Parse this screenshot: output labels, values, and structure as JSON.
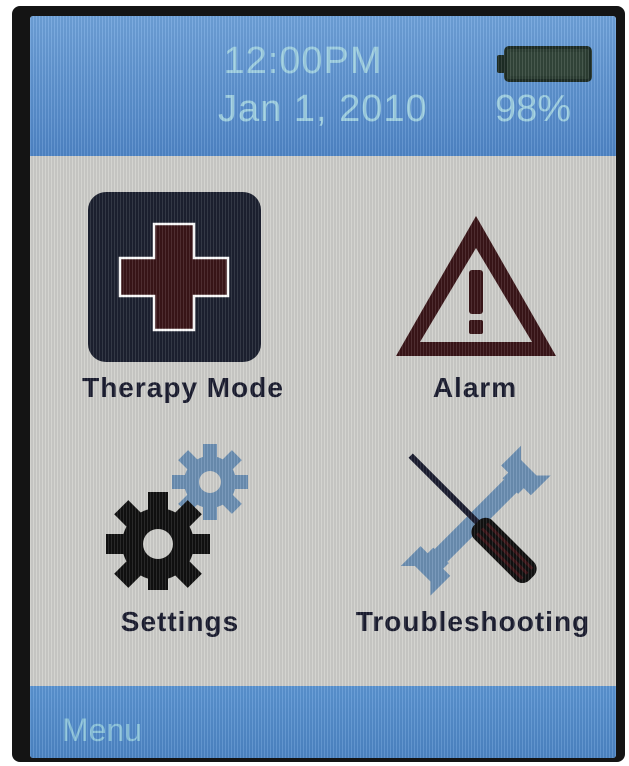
{
  "status": {
    "time": "12:00PM",
    "date": "Jan 1, 2010",
    "battery_percent": "98%",
    "battery_level": 0.98
  },
  "menu": {
    "items": [
      {
        "label": "Therapy Mode",
        "icon": "medical-cross-icon"
      },
      {
        "label": "Alarm",
        "icon": "warning-triangle-icon"
      },
      {
        "label": "Settings",
        "icon": "gears-icon"
      },
      {
        "label": "Troubleshooting",
        "icon": "tools-icon"
      }
    ]
  },
  "footer": {
    "label": "Menu"
  },
  "colors": {
    "header_blue": "#5b95d4",
    "screen_bg": "#cfcfcb",
    "icon_dark": "#1b1d30",
    "cross_red": "#3a1518",
    "gear_blue": "#6b8fb3"
  }
}
